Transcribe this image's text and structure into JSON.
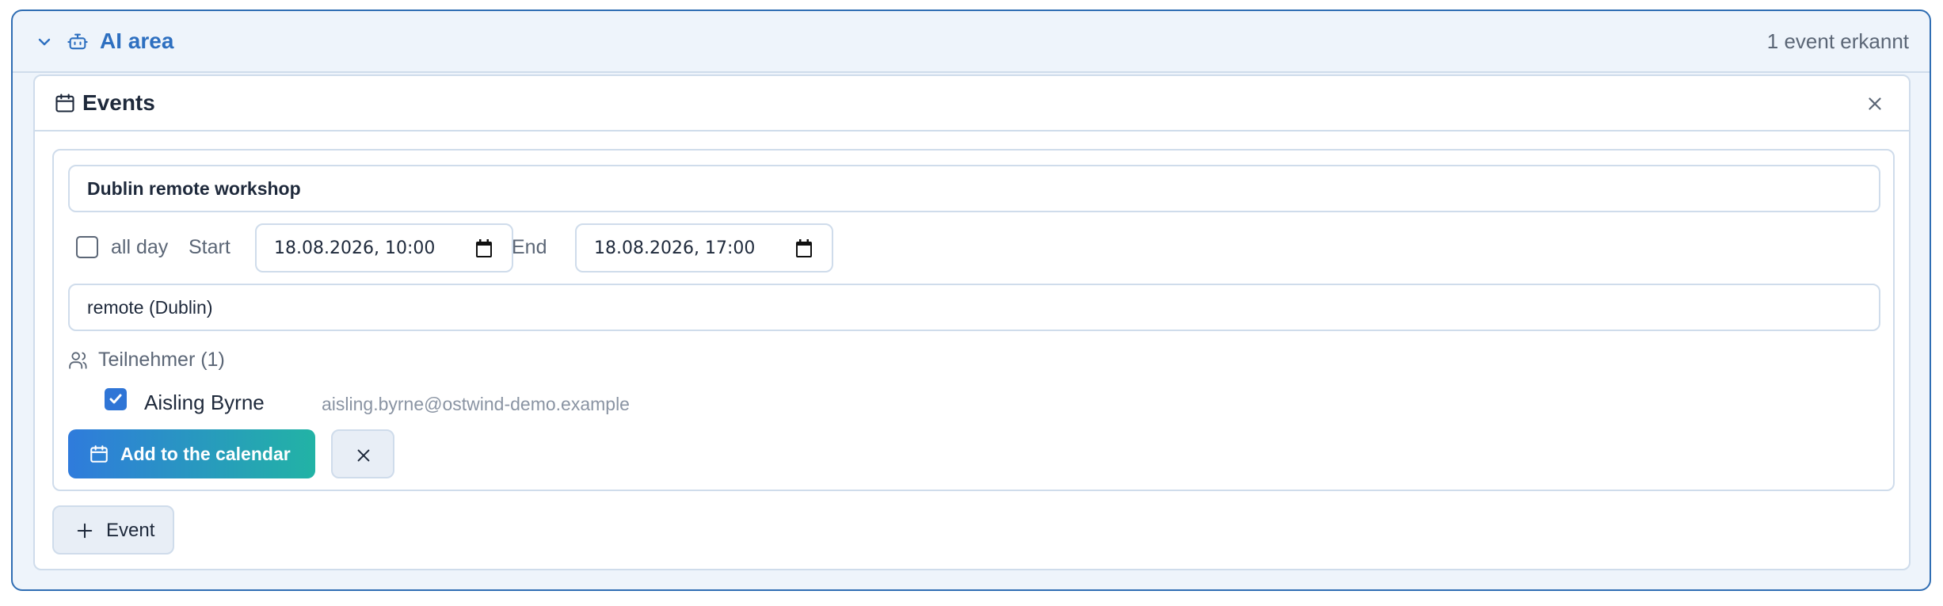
{
  "ai_area": {
    "title": "AI area",
    "detected_status": "1 event erkannt",
    "collapse_icon": "chevron-down-icon",
    "bot_icon": "robot-icon"
  },
  "events_panel": {
    "title": "Events",
    "title_icon": "calendar-icon",
    "close_icon": "close-icon"
  },
  "event": {
    "title": "Dublin remote workshop",
    "all_day_label": "all day",
    "all_day_checked": false,
    "start_label": "Start",
    "start_value": "18.08.2026, 10:00",
    "end_label": "End",
    "end_value": "18.08.2026, 17:00",
    "location": "remote (Dublin)",
    "participants_label": "Teilnehmer (1)",
    "participants": [
      {
        "name": "Aisling Byrne",
        "email": "aisling.byrne@ostwind-demo.example",
        "checked": true
      }
    ],
    "add_button_label": "Add to the calendar",
    "discard_icon": "close-icon"
  },
  "add_event_button_label": "Event",
  "colors": {
    "accent": "#2d6fc0",
    "border": "#cfdceb",
    "gradient_start": "#2f7bdc",
    "gradient_end": "#22b3a5"
  }
}
